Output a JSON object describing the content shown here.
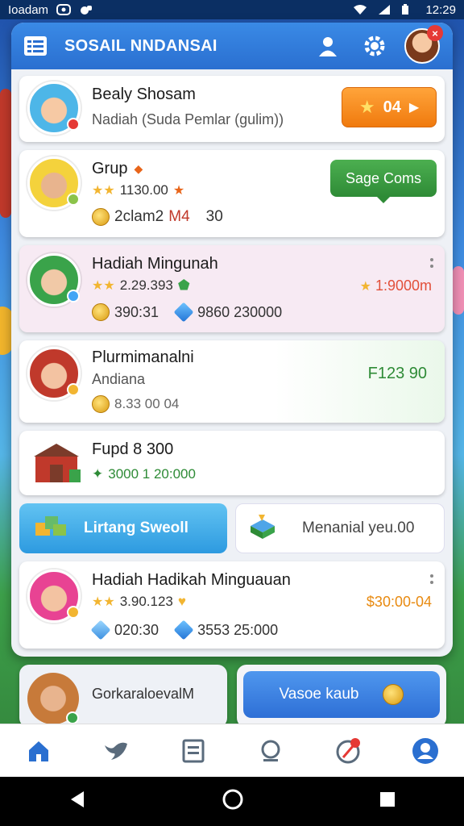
{
  "status_bar": {
    "carrier": "Ioadam",
    "time": "12:29"
  },
  "app": {
    "title": "SOSAIL NNDANSAI"
  },
  "cards": [
    {
      "name": "Bealy Shosam",
      "subtitle": "Nadiah (Suda Pemlar (gulim))",
      "button": "04"
    },
    {
      "name": "Grup",
      "rating": "1130.00",
      "stat": "2clam2",
      "stat_tag": "M4",
      "stat_value": "30",
      "button": "Sage Coms"
    },
    {
      "name": "Hadiah Mingunah",
      "rating": "2.29.393",
      "coins": "390:31",
      "gems": "9860 230000",
      "right_value": "1:9000m"
    },
    {
      "name": "Plurmimanalni",
      "subtitle": "Andiana",
      "coins": "8.33 00 04",
      "right_value": "F123 90"
    },
    {
      "name": "Fupd 8 300",
      "value": "3000 1 20:000"
    },
    {
      "name": "Hadiah Hadikah Minguauan",
      "rating": "3.90.123",
      "coins": "020:30",
      "gems": "3553 25:000",
      "right_value": "$30:00-04"
    }
  ],
  "actions": {
    "left_button": "Lirtang Sweoll",
    "right_button": "Menanial yeu.00"
  },
  "bottom_cards": {
    "left_label": "GorkaraloevalM",
    "right_button": "Vasoe kaub"
  },
  "nav": [
    "home-icon",
    "bird-icon",
    "list-icon",
    "search-icon",
    "compass-icon",
    "profile-icon"
  ]
}
